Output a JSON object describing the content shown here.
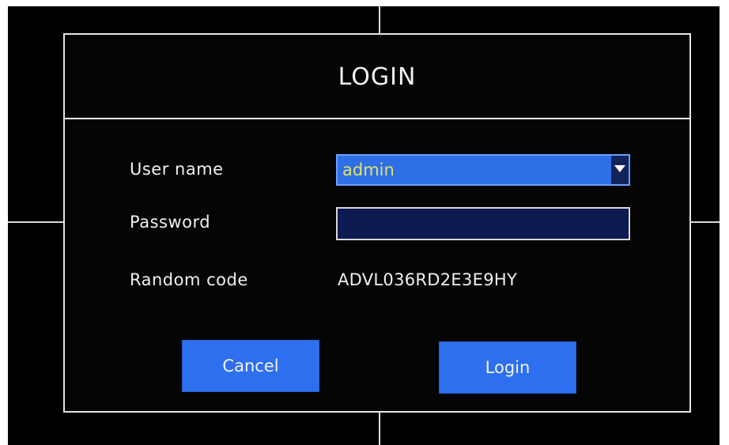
{
  "dialog": {
    "title": "LOGIN",
    "fields": {
      "username_label": "User name",
      "username_value": "admin",
      "password_label": "Password",
      "password_value": "",
      "random_code_label": "Random code",
      "random_code_value": "ADVL036RD2E3E9HY"
    },
    "buttons": {
      "cancel_label": "Cancel",
      "login_label": "Login"
    }
  },
  "colors": {
    "background": "#000000",
    "dialog_border": "#e6e6e6",
    "button_blue": "#2e6ff0",
    "select_blue": "#2f6fe6",
    "password_field_fill": "#0e1a52",
    "selected_value_text": "#e2e26a"
  },
  "icons": {
    "dropdown": "chevron-down-icon"
  }
}
